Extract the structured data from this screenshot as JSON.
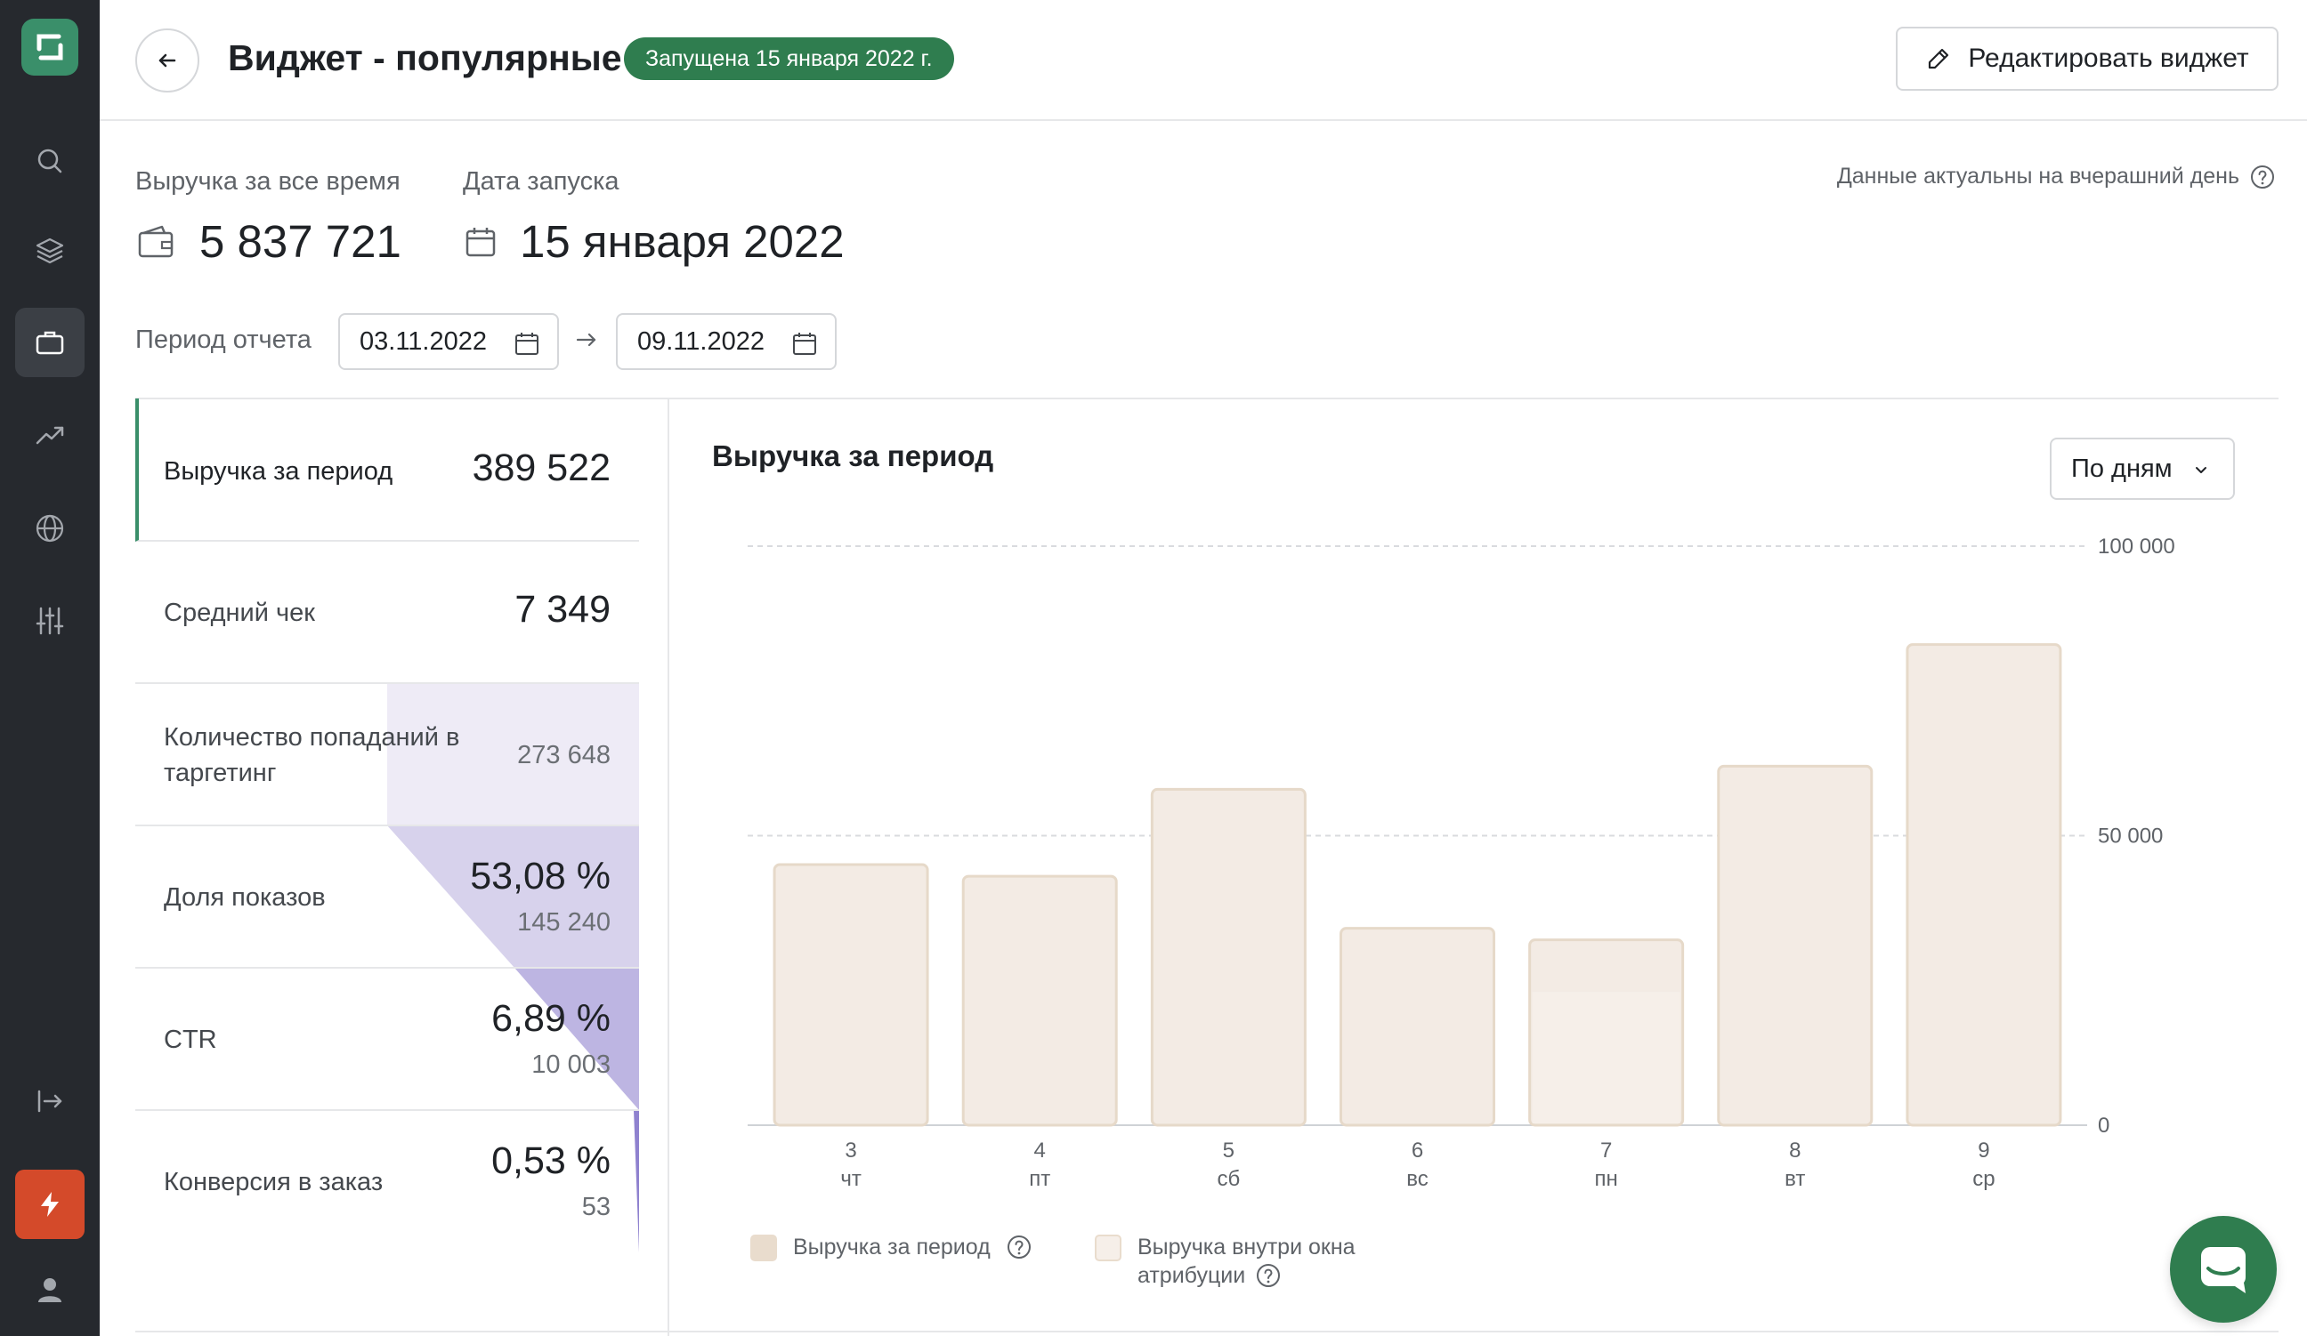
{
  "header": {
    "title": "Виджет - популярные",
    "status": "Запущена 15 января 2022 г.",
    "edit_label": "Редактировать виджет"
  },
  "summary": {
    "revenue_label": "Выручка за все время",
    "revenue_value": "5 837 721",
    "launch_label": "Дата запуска",
    "launch_value": "15 января 2022",
    "data_note": "Данные актуальны на вчерашний день"
  },
  "period": {
    "label": "Период отчета",
    "from": "03.11.2022",
    "to": "09.11.2022"
  },
  "metrics": [
    {
      "label": "Выручка за период",
      "value": "389 522",
      "sub": ""
    },
    {
      "label": "Средний чек",
      "value": "7 349",
      "sub": ""
    },
    {
      "label": "Количество попаданий в таргетинг",
      "value": "",
      "sub": "273 648"
    },
    {
      "label": "Доля показов",
      "value": "53,08 %",
      "sub": "145 240"
    },
    {
      "label": "CTR",
      "value": "6,89 %",
      "sub": "10 003"
    },
    {
      "label": "Конверсия в заказ",
      "value": "0,53 %",
      "sub": "53"
    }
  ],
  "chart": {
    "title": "Выручка за период",
    "grouping": "По дням"
  },
  "legend": {
    "period": "Выручка за период",
    "attribution_line1": "Выручка внутри окна",
    "attribution_line2": "атрибуции"
  },
  "colors": {
    "accent": "#3a8f6a",
    "bar_fill": "#f3ebe4",
    "bar_stroke": "#e6d9c9",
    "funnel_light": "#eeebf6",
    "funnel_mid": "#d7d2ec",
    "funnel_dark": "#bdb5e2",
    "funnel_darkest": "#8f82cf"
  },
  "chart_data": {
    "type": "bar",
    "categories": [
      "3",
      "4",
      "5",
      "6",
      "7",
      "8",
      "9"
    ],
    "weekdays": [
      "чт",
      "пт",
      "сб",
      "вс",
      "пн",
      "вт",
      "ср"
    ],
    "series": [
      {
        "name": "Выручка за период",
        "values": [
          45000,
          43000,
          58000,
          34000,
          32000,
          62000,
          83000
        ]
      },
      {
        "name": "Выручка внутри окна атрибуции",
        "values": [
          45000,
          43000,
          58000,
          34000,
          23000,
          62000,
          83000
        ]
      }
    ],
    "yticks": [
      "0",
      "50 000",
      "100 000"
    ],
    "ylim": [
      0,
      100000
    ],
    "grid": true
  }
}
